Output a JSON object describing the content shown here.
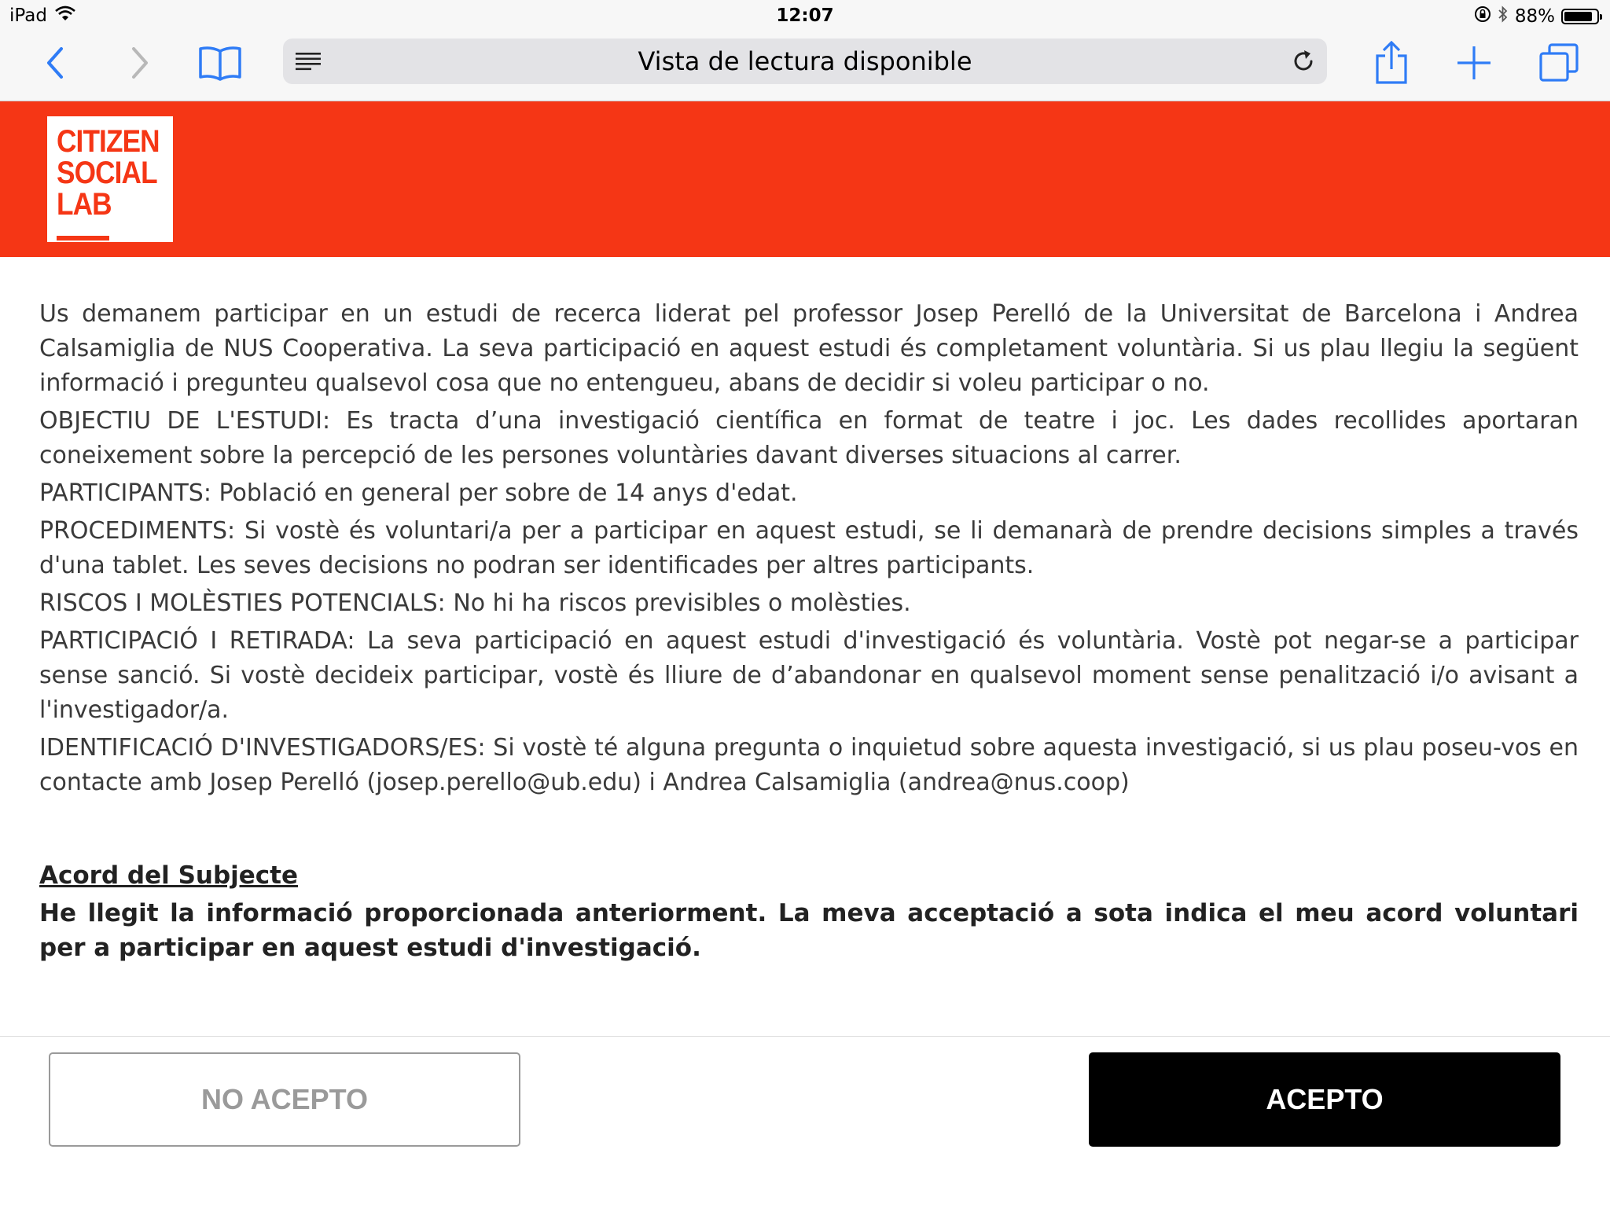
{
  "status_bar": {
    "device": "iPad",
    "time": "12:07",
    "battery_percent": "88%",
    "battery_level": 0.88
  },
  "browser": {
    "address_text": "Vista de lectura disponible",
    "icons": [
      "back-icon",
      "forward-icon",
      "bookmarks-icon",
      "reader-mode-icon",
      "reload-icon",
      "share-icon",
      "new-tab-icon",
      "tabs-icon"
    ]
  },
  "brand": {
    "logo_lines": [
      "CITIZEN",
      "SOCIAL",
      "LAB"
    ],
    "header_color": "#f53615"
  },
  "content": {
    "paragraphs": [
      "Us demanem participar en un estudi de recerca liderat pel professor Josep Perelló de la Universitat de Barcelona i Andrea Calsamiglia de NUS Cooperativa. La seva participació en aquest estudi és completament voluntària. Si us plau llegiu la següent informació i pregunteu qualsevol cosa que no entengueu, abans de decidir si voleu participar o no.",
      "OBJECTIU DE L'ESTUDI: Es tracta d’una investigació científica en format de teatre i joc. Les dades recollides aportaran coneixement sobre la percepció de les persones voluntàries davant diverses situacions al carrer.",
      "PARTICIPANTS: Població en general per sobre de 14 anys d'edat.",
      "PROCEDIMENTS: Si vostè és voluntari/a per a participar en aquest estudi, se li demanarà de prendre decisions simples a través d'una tablet. Les seves decisions no podran ser identificades per altres participants.",
      "RISCOS I MOLÈSTIES POTENCIALS: No hi ha riscos previsibles o molèsties.",
      "PARTICIPACIÓ I RETIRADA: La seva participació en aquest estudi d'investigació és voluntària. Vostè pot negar-se a participar sense sanció. Si vostè decideix participar, vostè és lliure de d’abandonar en qualsevol moment sense penalització i/o avisant a l'investigador/a.",
      "IDENTIFICACIÓ D'INVESTIGADORS/ES: Si vostè té alguna pregunta o inquietud sobre aquesta investigació, si us plau poseu-vos en contacte amb Josep Perelló (josep.perello@ub.edu) i Andrea Calsamiglia (andrea@nus.coop)"
    ],
    "agreement_title": "Acord del Subjecte",
    "agreement_text": "He llegit la informació proporcionada anteriorment. La meva acceptació a sota indica el meu acord voluntari per a participar en aquest estudi d'investigació."
  },
  "actions": {
    "decline_label": "NO ACEPTO",
    "accept_label": "ACEPTO"
  }
}
